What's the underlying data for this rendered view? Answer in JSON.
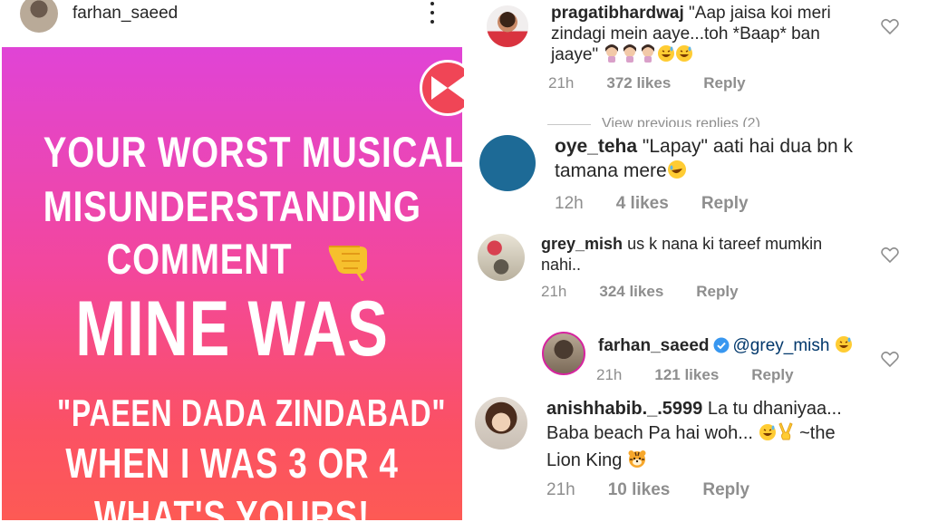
{
  "post": {
    "username": "farhan_saeed",
    "story_lines": [
      "YOUR WORST MUSICAL",
      "MISUNDERSTANDING",
      "COMMENT",
      "MINE WAS",
      "\"PAEEN DADA ZINDABAD\"",
      "WHEN I WAS 3 OR 4",
      "WHAT'S YOURS!"
    ],
    "story_gradient": [
      "#e044d6",
      "#f3479b",
      "#fb5165",
      "#fd5a54"
    ],
    "icons": {
      "more": "more-options-icon",
      "pointing": "pointing-down-hand-icon",
      "shot": "bowtie-app-icon"
    }
  },
  "comments": {
    "items": [
      {
        "username": "pragatibhardwaj",
        "text_lines": [
          "\"Aap jaisa koi meri",
          "zindagi mein aaye...toh *Baap* ban",
          "jaaye\""
        ],
        "time": "21h",
        "likes": "372 likes",
        "reply": "Reply"
      },
      {
        "username": "oye_teha",
        "text_lines": [
          "\"Lapay\" aati hai dua bn k",
          "tamana mere"
        ],
        "time": "12h",
        "likes": "4 likes",
        "reply": "Reply"
      },
      {
        "username": "grey_mish",
        "text_lines": [
          "us k nana ki tareef mumkin",
          "nahi.."
        ],
        "time": "21h",
        "likes": "324 likes",
        "reply": "Reply"
      },
      {
        "username": "farhan_saeed",
        "mention": "@grey_mish",
        "time": "21h",
        "likes": "121 likes",
        "reply": "Reply"
      },
      {
        "username": "anishhabib._.5999",
        "text_lines": [
          "La tu dhaniyaa...",
          "Baba beach Pa hai woh...",
          "~the",
          "Lion King"
        ],
        "time": "21h",
        "likes": "10 likes",
        "reply": "Reply"
      }
    ],
    "view_previous": "View previous replies (2)",
    "colors": {
      "meta": "#8e8e8e",
      "text": "#262626",
      "verified": "#3897f0",
      "avatar_oye_teha": "#1d6a96"
    }
  }
}
